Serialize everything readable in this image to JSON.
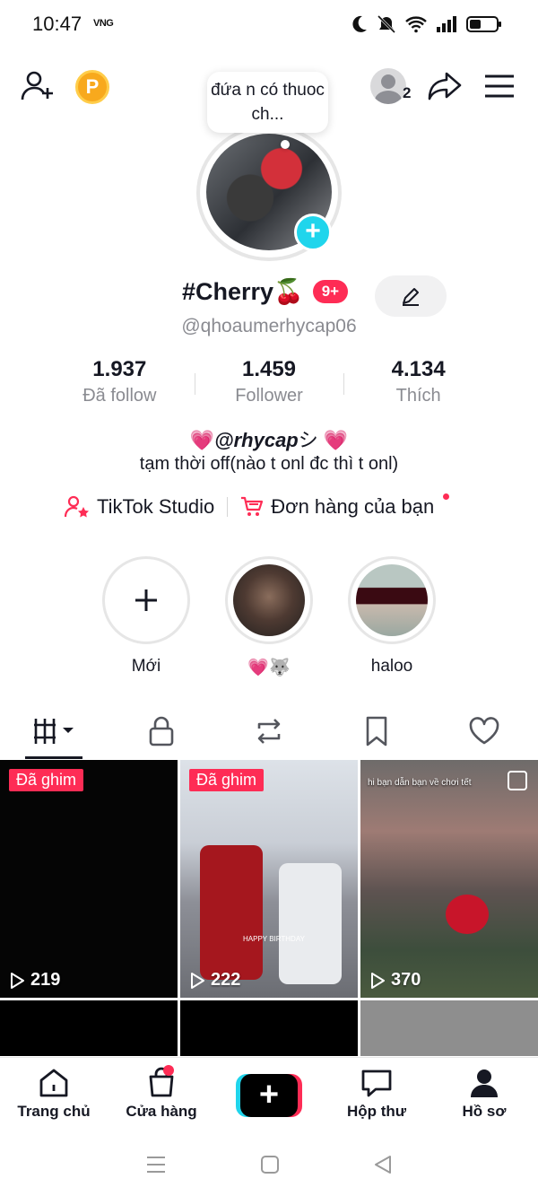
{
  "status_bar": {
    "time": "10:47",
    "carrier": "VNG"
  },
  "note": {
    "text": "đứa n có thuoc ch..."
  },
  "header": {
    "followers_badge": "2",
    "coin_label": "P"
  },
  "profile": {
    "display_name": "#Cherry🍒",
    "notif_badge": "9+",
    "username": "@qhoaumerhycap06"
  },
  "stats": [
    {
      "value": "1.937",
      "label": "Đã follow"
    },
    {
      "value": "1.459",
      "label": "Follower"
    },
    {
      "value": "4.134",
      "label": "Thích"
    }
  ],
  "bio": {
    "line1_prefix": "💗",
    "line1_handle": "@rhycap",
    "line1_suffix": "シ 💗",
    "line2": "tạm thời off(nào t onl đc thì t onl)"
  },
  "links": {
    "studio": "TikTok Studio",
    "orders": "Đơn hàng của bạn"
  },
  "stories": [
    {
      "label": "Mới"
    },
    {
      "label": "💗🐺"
    },
    {
      "label": "haloo"
    }
  ],
  "videos": [
    {
      "pinned_label": "Đã ghim",
      "views": "219"
    },
    {
      "pinned_label": "Đã ghim",
      "views": "222"
    },
    {
      "pinned_label": "",
      "views": "370",
      "overlay_text": "hi bạn dẫn bạn về chơi tết"
    }
  ],
  "video_overlay": {
    "birthday": "HAPPY BIRTHDAY"
  },
  "bottom_nav": [
    {
      "label": "Trang chủ"
    },
    {
      "label": "Cửa hàng"
    },
    {
      "label": "Hộp thư"
    },
    {
      "label": "Hồ sơ"
    }
  ]
}
